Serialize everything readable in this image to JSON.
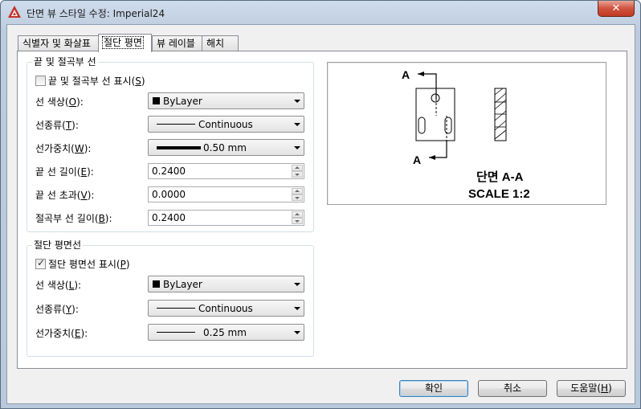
{
  "window": {
    "title": "단면 뷰 스타일 수정: Imperial24",
    "close_glyph": "✕"
  },
  "tabs": [
    {
      "label": "식별자 및 화살표"
    },
    {
      "label": "절단 평면"
    },
    {
      "label": "뷰 레이블"
    },
    {
      "label": "해치"
    }
  ],
  "end_lines": {
    "title": "끝 및 절곡부 선",
    "show_checkbox": {
      "label": "끝 및 절곡부 선 표시(",
      "mnemonic": "S",
      "suffix": ")",
      "checked": false
    },
    "color": {
      "label": "선 색상(",
      "mnemonic": "O",
      "suffix": "):",
      "value": "ByLayer"
    },
    "linetype": {
      "label": "선종류(",
      "mnemonic": "T",
      "suffix": "):",
      "value": "Continuous"
    },
    "lineweight": {
      "label": "선가중치(",
      "mnemonic": "W",
      "suffix": "):",
      "value": "0.50 mm"
    },
    "end_length": {
      "label": "끝 선 길이(",
      "mnemonic": "E",
      "suffix": "):",
      "value": "0.2400"
    },
    "end_overshoot": {
      "label": "끝 선 초과(",
      "mnemonic": "V",
      "suffix": "):",
      "value": "0.0000"
    },
    "bend_length": {
      "label": "절곡부 선 길이(",
      "mnemonic": "B",
      "suffix": "):",
      "value": "0.2400"
    }
  },
  "cutting_plane": {
    "title": "절단 평면선",
    "show_checkbox": {
      "label": "절단 평면선 표시(",
      "mnemonic": "P",
      "suffix": ")",
      "checked": true
    },
    "color": {
      "label": "선 색상(",
      "mnemonic": "L",
      "suffix": "):",
      "value": "ByLayer"
    },
    "linetype": {
      "label": "선종류(",
      "mnemonic": "Y",
      "suffix": "):",
      "value": "Continuous"
    },
    "lineweight": {
      "label": "선가중치(",
      "mnemonic": "E",
      "suffix": "):",
      "value": "0.25 mm"
    }
  },
  "preview": {
    "identifier_top": "A",
    "identifier_bottom": "A",
    "section_title": "단면 A-A",
    "scale_text": "SCALE 1:2"
  },
  "buttons": {
    "ok": "확인",
    "cancel": "취소",
    "help_label": "도움말(",
    "help_mnemonic": "H",
    "help_suffix": ")"
  },
  "colors": {
    "title_accent": "#c4302b",
    "close_button": "#c03a24"
  }
}
